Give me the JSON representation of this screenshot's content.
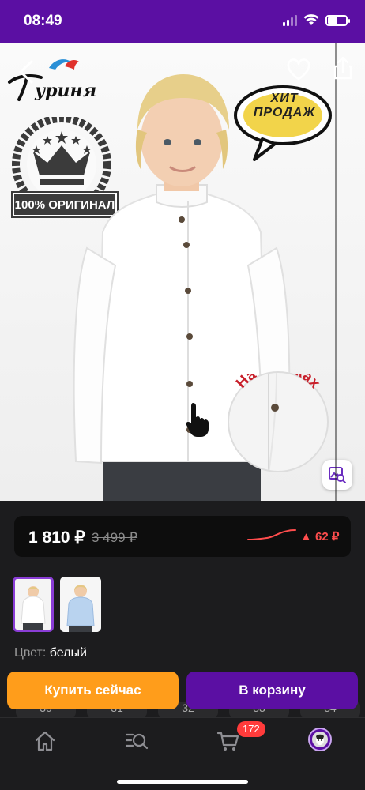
{
  "status": {
    "time": "08:49"
  },
  "hero": {
    "brand_text": "Туриня",
    "badge_label": "100% ОРИГИНАЛ",
    "hit_label_line1": "ХИТ",
    "hit_label_line2": "ПРОДАЖ",
    "zoom_label": "На кнопках"
  },
  "price": {
    "current": "1 810 ₽",
    "old": "3 499 ₽",
    "delta": "▲ 62 ₽"
  },
  "color": {
    "label": "Цвет:",
    "value": "белый"
  },
  "sizes": [
    "30",
    "31",
    "32",
    "33",
    "34"
  ],
  "actions": {
    "buy_now": "Купить сейчас",
    "add_to_cart": "В корзину"
  },
  "tabbar": {
    "cart_count": "172"
  },
  "colors": {
    "brand": "#5b0fa3",
    "buy": "#ff9d1b",
    "price_up": "#ff4d4d"
  }
}
